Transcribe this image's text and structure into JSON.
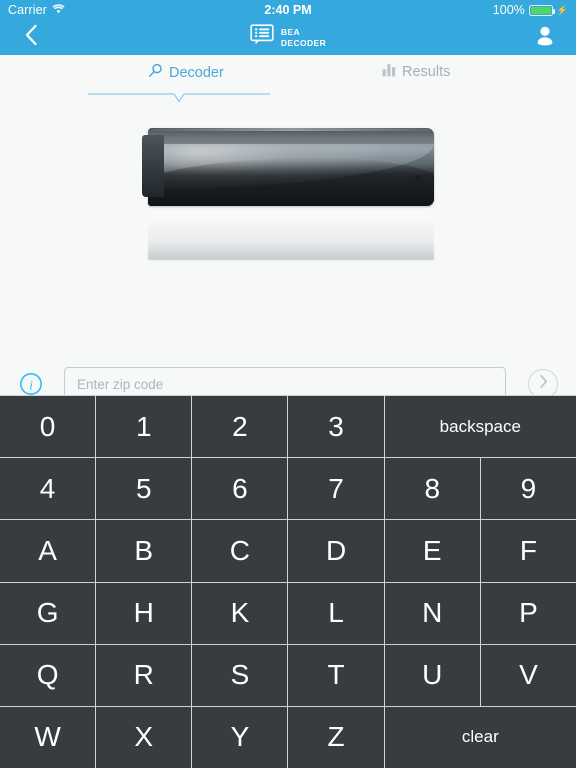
{
  "statusbar": {
    "carrier": "Carrier",
    "wifi_icon": "wifi-icon",
    "time": "2:40 PM",
    "battery_percent": "100%",
    "battery_icon": "battery-icon",
    "charging_icon": "lightning-bolt-icon"
  },
  "navbar": {
    "back_icon": "chevron-left-icon",
    "logo_icon": "speech-bubble-list-icon",
    "logo_line1": "BEA",
    "logo_line2": "DECODER",
    "user_icon": "user-avatar-icon"
  },
  "tabs": [
    {
      "label": "Decoder",
      "icon": "magnifier-icon",
      "active": true
    },
    {
      "label": "Results",
      "icon": "bar-chart-icon",
      "active": false
    }
  ],
  "hero": {
    "device_name": "set-top-box-decoder-image"
  },
  "zip_row": {
    "info_icon": "info-circle-icon",
    "input_value": "",
    "input_placeholder": "Enter zip code",
    "go_icon": "chevron-right-circle-icon"
  },
  "keyboard": {
    "keys": [
      {
        "label": "0",
        "wide": false
      },
      {
        "label": "1",
        "wide": false
      },
      {
        "label": "2",
        "wide": false
      },
      {
        "label": "3",
        "wide": false
      },
      {
        "label": "backspace",
        "wide": true
      },
      {
        "label": "4",
        "wide": false
      },
      {
        "label": "5",
        "wide": false
      },
      {
        "label": "6",
        "wide": false
      },
      {
        "label": "7",
        "wide": false
      },
      {
        "label": "8",
        "wide": false
      },
      {
        "label": "9",
        "wide": false
      },
      {
        "label": "A",
        "wide": false
      },
      {
        "label": "B",
        "wide": false
      },
      {
        "label": "C",
        "wide": false
      },
      {
        "label": "D",
        "wide": false
      },
      {
        "label": "E",
        "wide": false
      },
      {
        "label": "F",
        "wide": false
      },
      {
        "label": "G",
        "wide": false
      },
      {
        "label": "H",
        "wide": false
      },
      {
        "label": "K",
        "wide": false
      },
      {
        "label": "L",
        "wide": false
      },
      {
        "label": "N",
        "wide": false
      },
      {
        "label": "P",
        "wide": false
      },
      {
        "label": "Q",
        "wide": false
      },
      {
        "label": "R",
        "wide": false
      },
      {
        "label": "S",
        "wide": false
      },
      {
        "label": "T",
        "wide": false
      },
      {
        "label": "U",
        "wide": false
      },
      {
        "label": "V",
        "wide": false
      },
      {
        "label": "W",
        "wide": false
      },
      {
        "label": "X",
        "wide": false
      },
      {
        "label": "Y",
        "wide": false
      },
      {
        "label": "Z",
        "wide": false
      },
      {
        "label": "clear",
        "wide": true
      }
    ]
  },
  "colors": {
    "brand_blue": "#35a9dd",
    "tab_active": "#4aa8d8",
    "tab_inactive": "#9fb1ba",
    "key_bg": "#373c40",
    "page_bg": "#f7f8f8",
    "battery_green": "#4cd964"
  }
}
